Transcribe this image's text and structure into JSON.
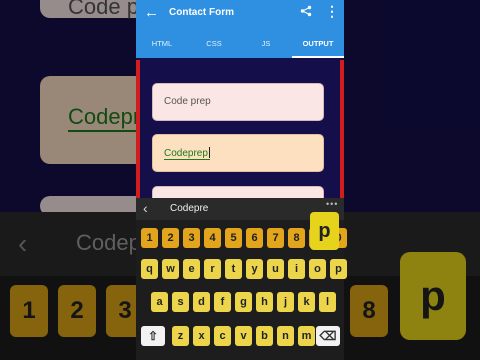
{
  "app": {
    "title": "Contact Form",
    "back_icon": "arrow-left-icon",
    "share_icon": "share-icon",
    "more_icon": "more-vert-icon",
    "tabs": [
      {
        "label": "HTML",
        "active": false
      },
      {
        "label": "CSS",
        "active": false
      },
      {
        "label": "JS",
        "active": false
      },
      {
        "label": "OUTPUT",
        "active": true
      }
    ],
    "accent": "#2f8fe0"
  },
  "form": {
    "field1_value": "Code prep",
    "field2_value": "Codeprep",
    "field3_value": ""
  },
  "suggestion_bar": {
    "word": "Codepre",
    "collapse_icon": "chevron-left-icon",
    "dots": "•••"
  },
  "keyboard": {
    "numbers": [
      "1",
      "2",
      "3",
      "4",
      "5",
      "6",
      "7",
      "8",
      "9",
      "0"
    ],
    "row1": [
      "q",
      "w",
      "e",
      "r",
      "t",
      "y",
      "u",
      "i",
      "o",
      "p"
    ],
    "row2": [
      "a",
      "s",
      "d",
      "f",
      "g",
      "h",
      "j",
      "k",
      "l"
    ],
    "row3": [
      "z",
      "x",
      "c",
      "v",
      "b",
      "n",
      "m"
    ],
    "shift_icon": "shift-icon",
    "backspace_icon": "backspace-icon",
    "popup_key": "p",
    "number_key_color": "#e2a51c",
    "letter_key_color": "#ecd54a"
  },
  "background": {
    "text_top": "Code prep",
    "text_mid": "Codeprep",
    "text_bar": "Codepre",
    "keys": [
      "1",
      "2",
      "3",
      "8"
    ],
    "big_key": "p"
  }
}
